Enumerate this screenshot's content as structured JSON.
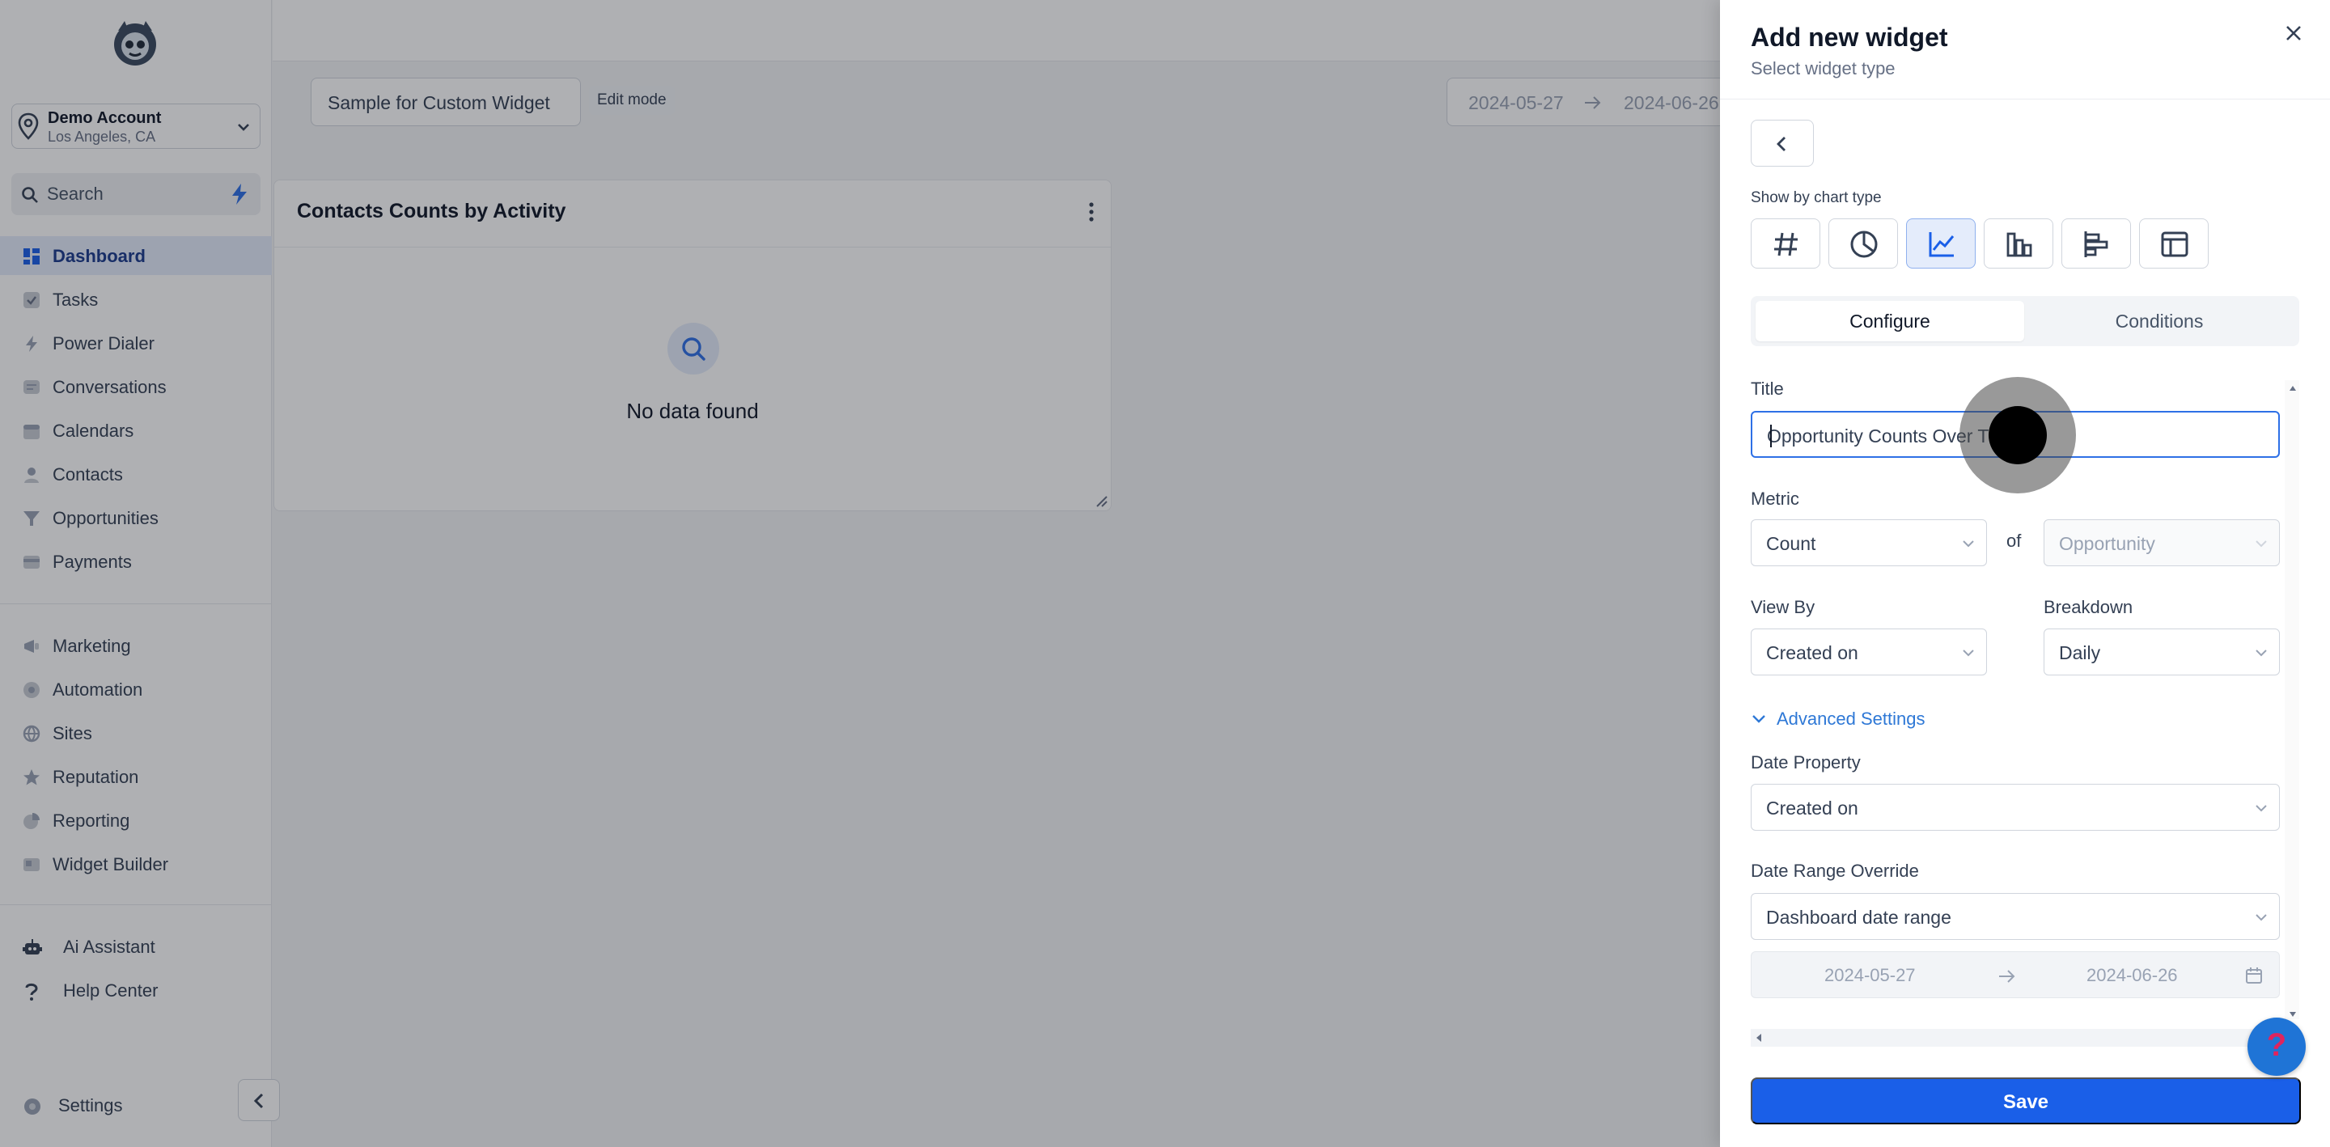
{
  "sidebar": {
    "account": {
      "name": "Demo Account",
      "location": "Los Angeles, CA"
    },
    "search": {
      "label": "Search"
    },
    "nav_primary": [
      {
        "label": "Dashboard",
        "icon": "dashboard-icon",
        "active": true
      },
      {
        "label": "Tasks",
        "icon": "tasks-icon"
      },
      {
        "label": "Power Dialer",
        "icon": "power-dialer-icon"
      },
      {
        "label": "Conversations",
        "icon": "conversations-icon"
      },
      {
        "label": "Calendars",
        "icon": "calendar-icon"
      },
      {
        "label": "Contacts",
        "icon": "contacts-icon"
      },
      {
        "label": "Opportunities",
        "icon": "opportunities-icon"
      },
      {
        "label": "Payments",
        "icon": "payments-icon"
      }
    ],
    "nav_secondary": [
      {
        "label": "Marketing",
        "icon": "marketing-icon"
      },
      {
        "label": "Automation",
        "icon": "automation-icon"
      },
      {
        "label": "Sites",
        "icon": "sites-icon"
      },
      {
        "label": "Reputation",
        "icon": "reputation-icon"
      },
      {
        "label": "Reporting",
        "icon": "reporting-icon"
      },
      {
        "label": "Widget Builder",
        "icon": "widget-builder-icon"
      }
    ],
    "nav_tertiary": [
      {
        "label": "Ai Assistant",
        "icon": "robot-icon"
      },
      {
        "label": "Help Center",
        "icon": "help-icon"
      }
    ],
    "settings": {
      "label": "Settings",
      "icon": "settings-icon"
    }
  },
  "toolbar": {
    "dashboard_name": "Sample for Custom Widget",
    "edit_mode": "Edit mode",
    "date_start": "2024-05-27",
    "date_end": "2024-06-26"
  },
  "widget_card": {
    "title": "Contacts Counts by Activity",
    "empty_text": "No data found"
  },
  "drawer": {
    "title": "Add new widget",
    "subtitle": "Select widget type",
    "chart_type_label": "Show by chart type",
    "chart_types": [
      {
        "icon": "number-icon"
      },
      {
        "icon": "pie-chart-icon"
      },
      {
        "icon": "line-chart-icon",
        "active": true
      },
      {
        "icon": "bar-chart-icon"
      },
      {
        "icon": "horizontal-bar-chart-icon"
      },
      {
        "icon": "table-icon"
      }
    ],
    "tabs": {
      "configure": "Configure",
      "conditions": "Conditions"
    },
    "form": {
      "title_label": "Title",
      "title_value": "Opportunity Counts Over Time",
      "metric_label": "Metric",
      "metric_value": "Count",
      "of_label": "of",
      "metric_object": "Opportunity",
      "view_by_label": "View By",
      "view_by_value": "Created on",
      "breakdown_label": "Breakdown",
      "breakdown_value": "Daily",
      "advanced_label": "Advanced Settings",
      "date_property_label": "Date Property",
      "date_property_value": "Created on",
      "date_range_override_label": "Date Range Override",
      "date_range_override_value": "Dashboard date range",
      "override_start": "2024-05-27",
      "override_end": "2024-06-26"
    },
    "save_label": "Save",
    "help_glyph": "?"
  },
  "colors": {
    "primary": "#1a5fe8",
    "link": "#2e78d6",
    "active_nav_bg": "#e4ecfb"
  }
}
